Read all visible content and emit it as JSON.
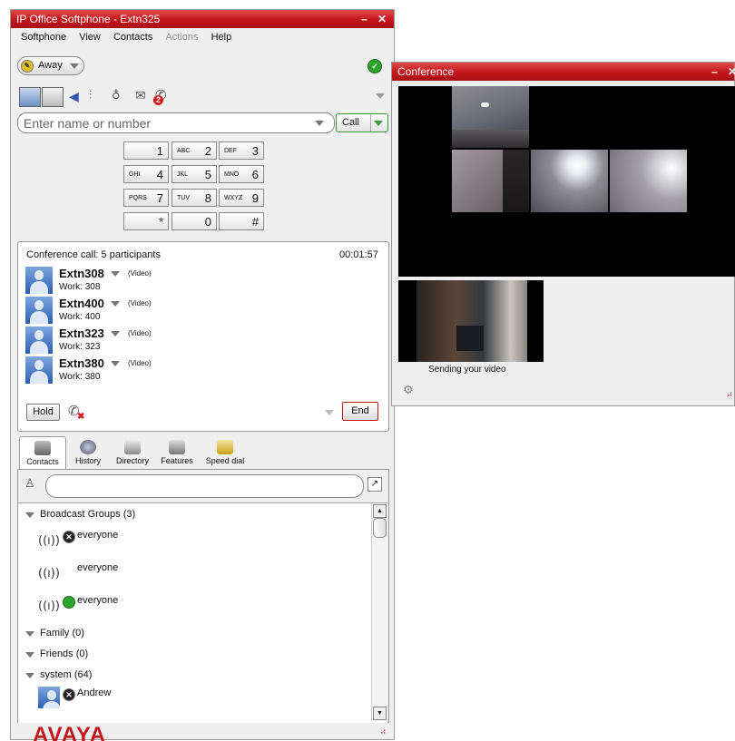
{
  "main_window": {
    "title": "IP Office Softphone - Extn325",
    "minimize": "–",
    "close": "✕",
    "menu": [
      "Softphone",
      "View",
      "Contacts",
      "Actions",
      "Help"
    ],
    "presence": "Away",
    "search_placeholder": "Enter name or number",
    "call_label": "Call",
    "keypad": [
      {
        "sub": "",
        "num": "1"
      },
      {
        "sub": "ABC",
        "num": "2"
      },
      {
        "sub": "DEF",
        "num": "3"
      },
      {
        "sub": "GHI",
        "num": "4"
      },
      {
        "sub": "JKL",
        "num": "5"
      },
      {
        "sub": "MNO",
        "num": "6"
      },
      {
        "sub": "PQRS",
        "num": "7"
      },
      {
        "sub": "TUV",
        "num": "8"
      },
      {
        "sub": "WXYZ",
        "num": "9"
      },
      {
        "sub": "",
        "num": "*"
      },
      {
        "sub": "",
        "num": "0"
      },
      {
        "sub": "",
        "num": "#"
      }
    ],
    "voicemail_count": "2",
    "call_panel": {
      "title": "Conference call: 5 participants",
      "timer": "00:01:57",
      "participants": [
        {
          "name": "Extn308",
          "tag": "(Video)",
          "work": "Work: 308"
        },
        {
          "name": "Extn400",
          "tag": "(Video)",
          "work": "Work: 400"
        },
        {
          "name": "Extn323",
          "tag": "(Video)",
          "work": "Work: 323"
        },
        {
          "name": "Extn380",
          "tag": "(Video)",
          "work": "Work: 380"
        }
      ],
      "hold_label": "Hold",
      "end_label": "End"
    },
    "tabs": [
      "Contacts",
      "History",
      "Directory",
      "Features",
      "Speed dial"
    ],
    "contacts": {
      "groups": [
        {
          "label": "Broadcast Groups (3)"
        },
        {
          "label": "Family (0)"
        },
        {
          "label": "Friends (0)"
        },
        {
          "label": "system (64)"
        }
      ],
      "broadcast_items": [
        "everyone",
        "everyone",
        "everyone"
      ],
      "system_items": [
        "Andrew"
      ]
    },
    "brand": "AVAYA"
  },
  "conference_window": {
    "title": "Conference",
    "minimize": "–",
    "close": "✕",
    "self_caption": "Sending your video"
  },
  "colors": {
    "title_red": "#c3161c",
    "status_green": "#2aa52a",
    "end_border": "#c01818",
    "call_border": "#3a9a3a"
  }
}
